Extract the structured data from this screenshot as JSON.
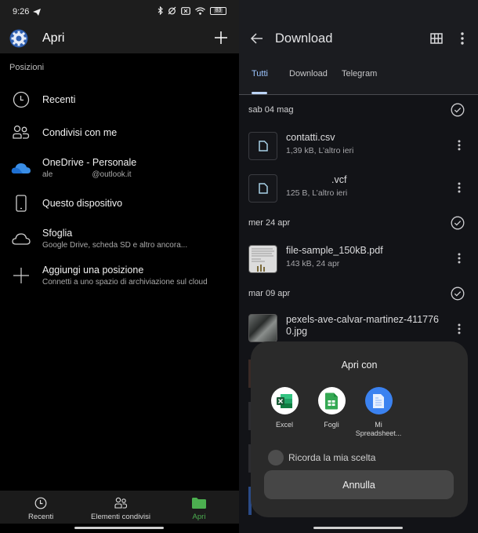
{
  "left": {
    "status": {
      "time": "9:26",
      "battery": "83"
    },
    "header": {
      "title": "Apri"
    },
    "section_label": "Posizioni",
    "locations": [
      {
        "icon": "clock-icon",
        "title": "Recenti",
        "subtitle": ""
      },
      {
        "icon": "shared-people-icon",
        "title": "Condivisi con me",
        "subtitle": ""
      },
      {
        "icon": "onedrive-cloud-icon",
        "title": "OneDrive - Personale",
        "subtitle_prefix": "ale",
        "subtitle_suffix": "@outlook.it"
      },
      {
        "icon": "phone-icon",
        "title": "Questo dispositivo",
        "subtitle": ""
      },
      {
        "icon": "cloud-outline-icon",
        "title": "Sfoglia",
        "subtitle": "Google Drive, scheda SD e altro ancora..."
      },
      {
        "icon": "plus-icon",
        "title": "Aggiungi una posizione",
        "subtitle": "Connetti a uno spazio di archiviazione sul cloud"
      }
    ],
    "bottom_nav": [
      {
        "label": "Recenti",
        "active": false
      },
      {
        "label": "Elementi condivisi",
        "active": false
      },
      {
        "label": "Apri",
        "active": true
      }
    ],
    "accent": "#4caf50"
  },
  "right": {
    "header": {
      "title": "Download"
    },
    "tabs": [
      {
        "label": "Tutti",
        "active": true
      },
      {
        "label": "Download",
        "active": false
      },
      {
        "label": "Telegram",
        "active": false
      }
    ],
    "groups": [
      {
        "date": "sab 04 mag",
        "files": [
          {
            "name": "contatti.csv",
            "meta": "1,39 kB, L’altro ieri",
            "thumb": "doc"
          },
          {
            "name": ".vcf",
            "meta": "125 B, L’altro ieri",
            "thumb": "doc"
          }
        ]
      },
      {
        "date": "mer 24 apr",
        "files": [
          {
            "name": "file-sample_150kB.pdf",
            "meta": "143 kB, 24 apr",
            "thumb": "pdf"
          }
        ]
      },
      {
        "date": "mar 09 apr",
        "files": [
          {
            "name": "pexels-ave-calvar-martinez-4117760.jpg",
            "name_line1": "pexels-ave-calvar-martinez-411776",
            "name_line2": "0.jpg",
            "meta": "",
            "thumb": "photo"
          }
        ]
      }
    ],
    "sheet": {
      "title": "Apri con",
      "apps": [
        {
          "label": "Excel",
          "icon": "excel-icon"
        },
        {
          "label": "Fogli",
          "icon": "sheets-icon"
        },
        {
          "label": "Mi Spreadsheet...",
          "label_line1": "Mi",
          "label_line2": "Spreadsheet...",
          "icon": "mi-spreadsheet-icon"
        }
      ],
      "remember_label": "Ricorda la mia scelta",
      "remember_checked": false,
      "cancel_label": "Annulla"
    }
  }
}
